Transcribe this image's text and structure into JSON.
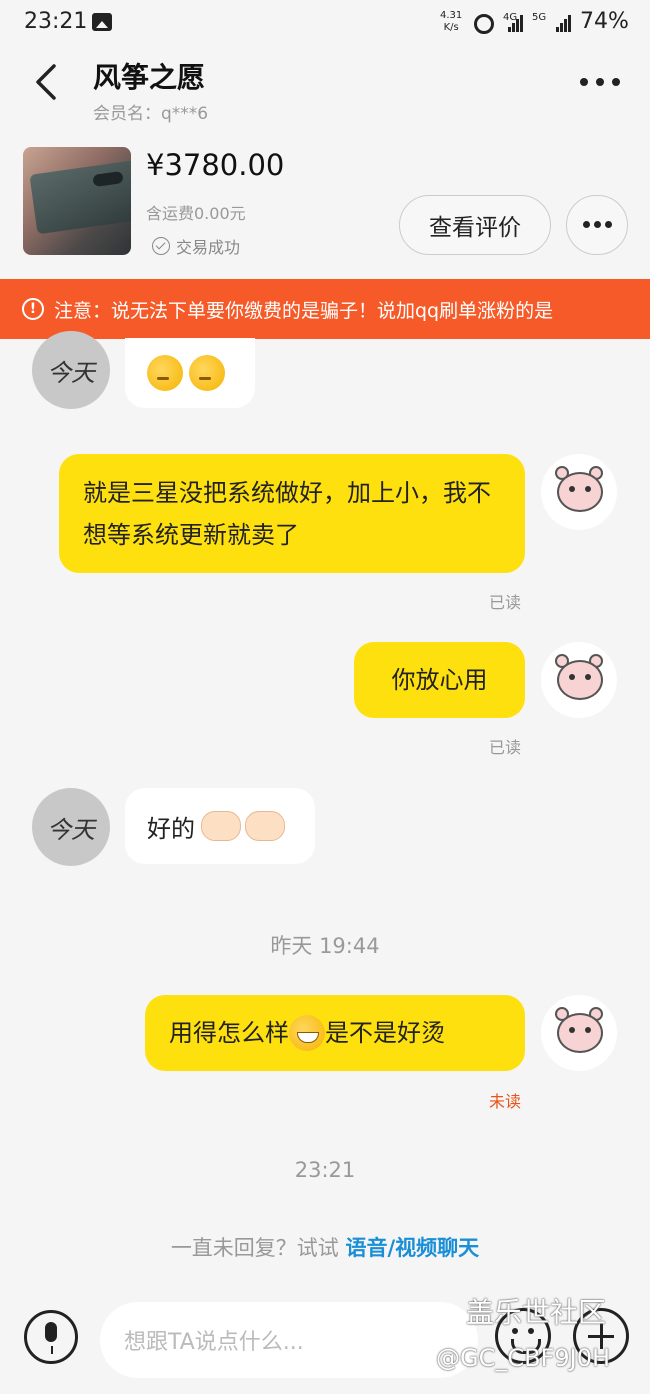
{
  "status_bar": {
    "time": "23:21",
    "net_speed_value": "4.31",
    "net_speed_unit": "K/s",
    "sig1_label": "4G",
    "sig2_label": "5G",
    "battery": "74%"
  },
  "header": {
    "title": "风筝之愿",
    "member": "会员名：q***6"
  },
  "product": {
    "price": "¥3780.00",
    "shipping": "含运费0.00元",
    "status": "交易成功",
    "review_button": "查看评价"
  },
  "warning": {
    "text": "注意：说无法下单要你缴费的是骗子！说加qq刷单涨粉的是"
  },
  "chat": {
    "msg2": "就是三星没把系统做好，加上小，我不想等系统更新就卖了",
    "msg2_status": "已读",
    "msg3": "你放心用",
    "msg3_status": "已读",
    "msg4": "好的",
    "time1": "昨天 19:44",
    "msg5_a": "用得怎么样",
    "msg5_b": "是不是好烫",
    "msg5_status": "未读",
    "time2": "23:21"
  },
  "hint": {
    "prefix": "一直未回复？试试 ",
    "link": "语音/视频聊天"
  },
  "input": {
    "placeholder": "想跟TA说点什么..."
  },
  "watermark": {
    "line1": "盖乐世社区",
    "line2": "@GC_CBF9J0H"
  },
  "colors": {
    "accent_yellow": "#ffe00f",
    "warning_orange": "#f55a28",
    "link_blue": "#1a8fd6"
  }
}
